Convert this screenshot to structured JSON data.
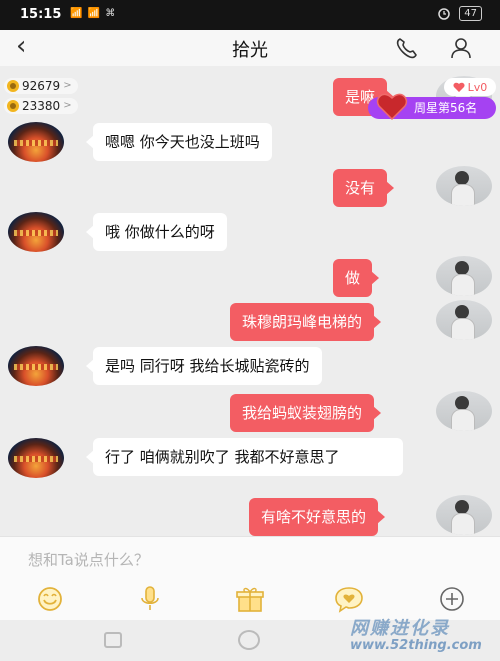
{
  "status_bar": {
    "time": "15:15",
    "signal": "📶 📶 ⌘",
    "battery": "47"
  },
  "header": {
    "title": "拾光",
    "icons": [
      "back-arrow",
      "phone-icon",
      "person-icon"
    ]
  },
  "stats": [
    {
      "value": "92679",
      "arrow": ">"
    },
    {
      "value": "23380",
      "arrow": ">"
    }
  ],
  "like_badge": {
    "text": "Lv0"
  },
  "rank_badge": {
    "text": "周星第56名"
  },
  "messages": [
    {
      "side": "out",
      "text": "是嘛"
    },
    {
      "side": "in",
      "text": "嗯嗯  你今天也没上班吗"
    },
    {
      "side": "out",
      "text": "没有"
    },
    {
      "side": "in",
      "text": "哦 你做什么的呀"
    },
    {
      "side": "out",
      "text": "做"
    },
    {
      "side": "out",
      "text": "珠穆朗玛峰电梯的"
    },
    {
      "side": "in",
      "text": "是吗  同行呀  我给长城贴瓷砖的"
    },
    {
      "side": "out",
      "text": "我给蚂蚁装翅膀的"
    },
    {
      "side": "in",
      "text": "行了  咱俩就别吹了  我都不好意思了"
    },
    {
      "side": "out",
      "text": "有啥不好意思的"
    }
  ],
  "input": {
    "placeholder": "想和Ta说点什么？"
  },
  "toolbar": [
    "emoji-icon",
    "microphone-icon",
    "gift-icon",
    "heart-chat-icon",
    "plus-icon"
  ],
  "watermark": {
    "line1": "网赚进化录",
    "line2": "www.52thing.com"
  },
  "colors": {
    "accent": "#f35d63",
    "rank": "#a542f2",
    "coin": "#f2b51f"
  }
}
